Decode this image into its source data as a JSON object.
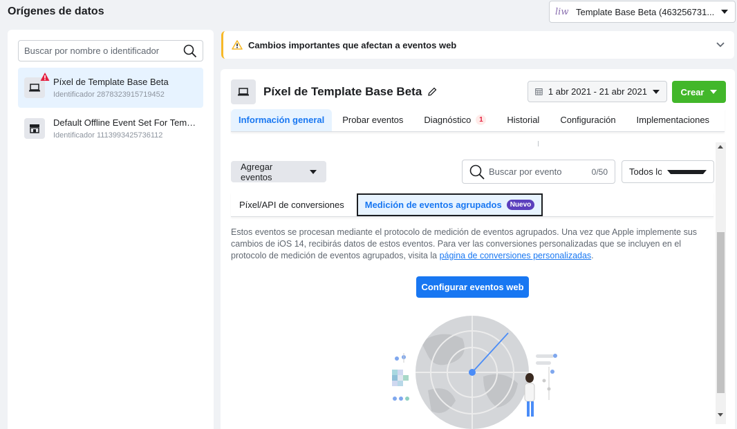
{
  "header": {
    "title": "Orígenes de datos",
    "account_logo": "liw",
    "account_name": "Template Base Beta (463256731..."
  },
  "sidebar": {
    "search_placeholder": "Buscar por nombre o identificador",
    "sources": [
      {
        "name": "Píxel de Template Base Beta",
        "id": "Identificador 2878323915719452",
        "icon": "laptop-icon",
        "warning": true,
        "selected": true
      },
      {
        "name": "Default Offline Event Set For Templa...",
        "id": "Identificador 1113993425736112",
        "icon": "store-icon",
        "warning": false,
        "selected": false
      }
    ]
  },
  "banner": {
    "text": "Cambios importantes que afectan a eventos web"
  },
  "panel": {
    "pixel_name": "Píxel de Template Base Beta",
    "date_range": "1 abr 2021 - 21 abr 2021",
    "create_label": "Crear",
    "tabs": [
      {
        "label": "Información general",
        "active": true
      },
      {
        "label": "Probar eventos"
      },
      {
        "label": "Diagnóstico",
        "badge": "1"
      },
      {
        "label": "Historial"
      },
      {
        "label": "Configuración"
      },
      {
        "label": "Implementaciones"
      }
    ],
    "add_events_label": "Agregar eventos",
    "event_search_placeholder": "Buscar por evento",
    "event_search_count": "0/50",
    "filter_value": "Todos los eve...",
    "subtabs": [
      {
        "label": "Píxel/API de conversiones"
      },
      {
        "label": "Medición de eventos agrupados",
        "badge": "Nuevo",
        "active": true
      }
    ],
    "info_text": "Estos eventos se procesan mediante el protocolo de medición de eventos agrupados. Una vez que Apple implemente sus cambios de iOS 14, recibirás datos de estos eventos. Para ver las conversiones personalizadas que se incluyen en el protocolo de medición de eventos agrupados, visita la ",
    "info_link": "página de conversiones personalizadas",
    "info_end": ".",
    "config_button": "Configurar eventos web"
  },
  "colors": {
    "primary": "#1877f2",
    "create": "#42b72a",
    "warning": "#f7b928",
    "new_badge": "#5b3fbd"
  }
}
